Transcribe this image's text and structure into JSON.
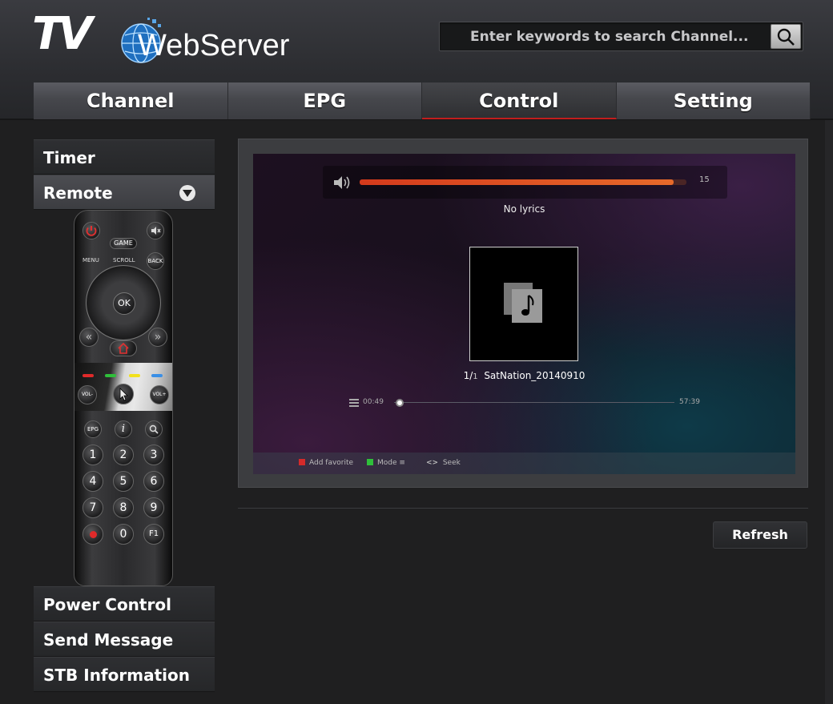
{
  "logo": {
    "tv": "TV",
    "webserver": "WebServer"
  },
  "search": {
    "placeholder": "Enter keywords to search Channel..."
  },
  "tabs": [
    {
      "label": "Channel",
      "active": false
    },
    {
      "label": "EPG",
      "active": false
    },
    {
      "label": "Control",
      "active": true
    },
    {
      "label": "Setting",
      "active": false
    }
  ],
  "sidebar": {
    "items": [
      {
        "label": "Timer"
      },
      {
        "label": "Remote",
        "expanded": true
      },
      {
        "label": "Power Control"
      },
      {
        "label": "Send Message"
      },
      {
        "label": "STB Information"
      }
    ]
  },
  "remote": {
    "game": "GAME",
    "menu": "MENU",
    "scroll": "SCROLL",
    "back": "BACK",
    "ok": "OK",
    "vol_minus": "VOL-",
    "vol_plus": "VOL+",
    "epg": "EPG",
    "info": "i",
    "numbers": [
      "1",
      "2",
      "3",
      "4",
      "5",
      "6",
      "7",
      "8",
      "9",
      "0"
    ],
    "f1": "F1"
  },
  "player": {
    "volume_level": 15,
    "volume_fraction": 0.96,
    "lyrics": "No lyrics",
    "track_index": "1/",
    "track_total": "1",
    "track_name": "SatNation_20140910",
    "time_elapsed": "00:49",
    "time_total": "57:39",
    "progress_fraction": 0.01,
    "hints": {
      "red": "Add favorite",
      "green": "Mode",
      "seek": "Seek"
    }
  },
  "actions": {
    "refresh": "Refresh"
  },
  "colors": {
    "accent_red": "#c21d1d",
    "volume_fill": "#d43a1c"
  }
}
